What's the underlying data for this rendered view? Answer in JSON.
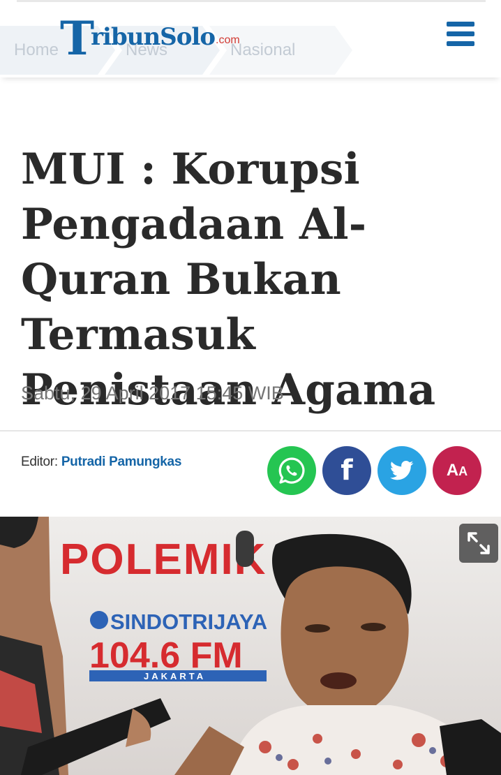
{
  "header": {
    "logo": {
      "main_initial": "T",
      "main_rest": "ribunSolo",
      "suffix": ".com"
    },
    "menu_icon": "hamburger-menu-icon",
    "breadcrumb": [
      "Home",
      "News",
      "Nasional"
    ]
  },
  "article": {
    "title": "MUI : Korupsi Pengadaan Al-Quran Bukan Termasuk Penistaan Agama",
    "date": "Sabtu, 29 April 2017 15:45 WIB",
    "editor_label": "Editor:",
    "editor_name": "Putradi Pamungkas"
  },
  "share": {
    "whatsapp_icon": "whatsapp-icon",
    "facebook_label": "f",
    "twitter_icon": "twitter-bird-icon",
    "font_size_label_big": "A",
    "font_size_label_small": "A"
  },
  "photo": {
    "backdrop_brand": "POLEMIK",
    "station_name": "SINDOTRIJAYA",
    "frequency": "104.6 FM",
    "city": "JAKARTA",
    "expand_icon": "expand-arrows-icon"
  },
  "colors": {
    "brand_blue": "#1565a7",
    "whatsapp": "#25c552",
    "facebook": "#2f4e96",
    "twitter": "#2aa3e3",
    "fontsize": "#c2224f"
  }
}
